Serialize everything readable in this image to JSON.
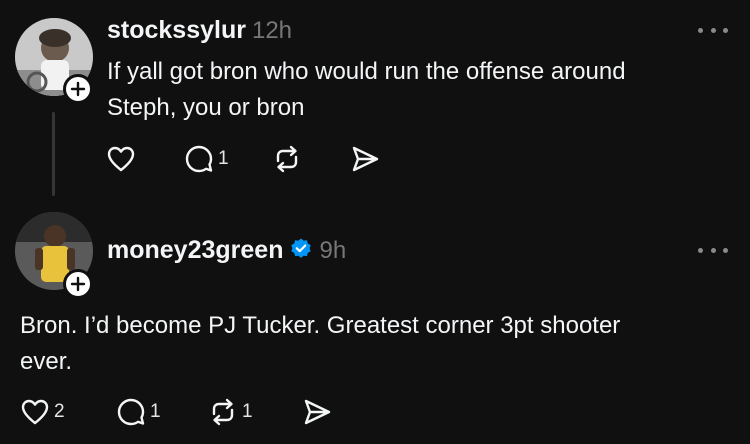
{
  "posts": [
    {
      "username": "stockssylur",
      "timestamp": "12h",
      "verified": false,
      "text_lines": [
        "If yall got bron who would run the offense around",
        "Steph, you or bron"
      ],
      "likes": "",
      "replies": "1",
      "reposts": ""
    },
    {
      "username": "money23green",
      "timestamp": "9h",
      "verified": true,
      "text_lines": [
        "Bron. I’d become PJ Tucker. Greatest corner 3pt shooter",
        "ever."
      ],
      "likes": "2",
      "replies": "1",
      "reposts": "1"
    }
  ],
  "icons": {
    "like": "heart-icon",
    "reply": "comment-icon",
    "repost": "repost-icon",
    "share": "send-icon",
    "more": "more-icon",
    "follow": "plus-icon",
    "verified": "verified-badge-icon"
  },
  "colors": {
    "background": "#101010",
    "text": "#f3f5f7",
    "muted": "#777777",
    "verified": "#0095f6"
  }
}
